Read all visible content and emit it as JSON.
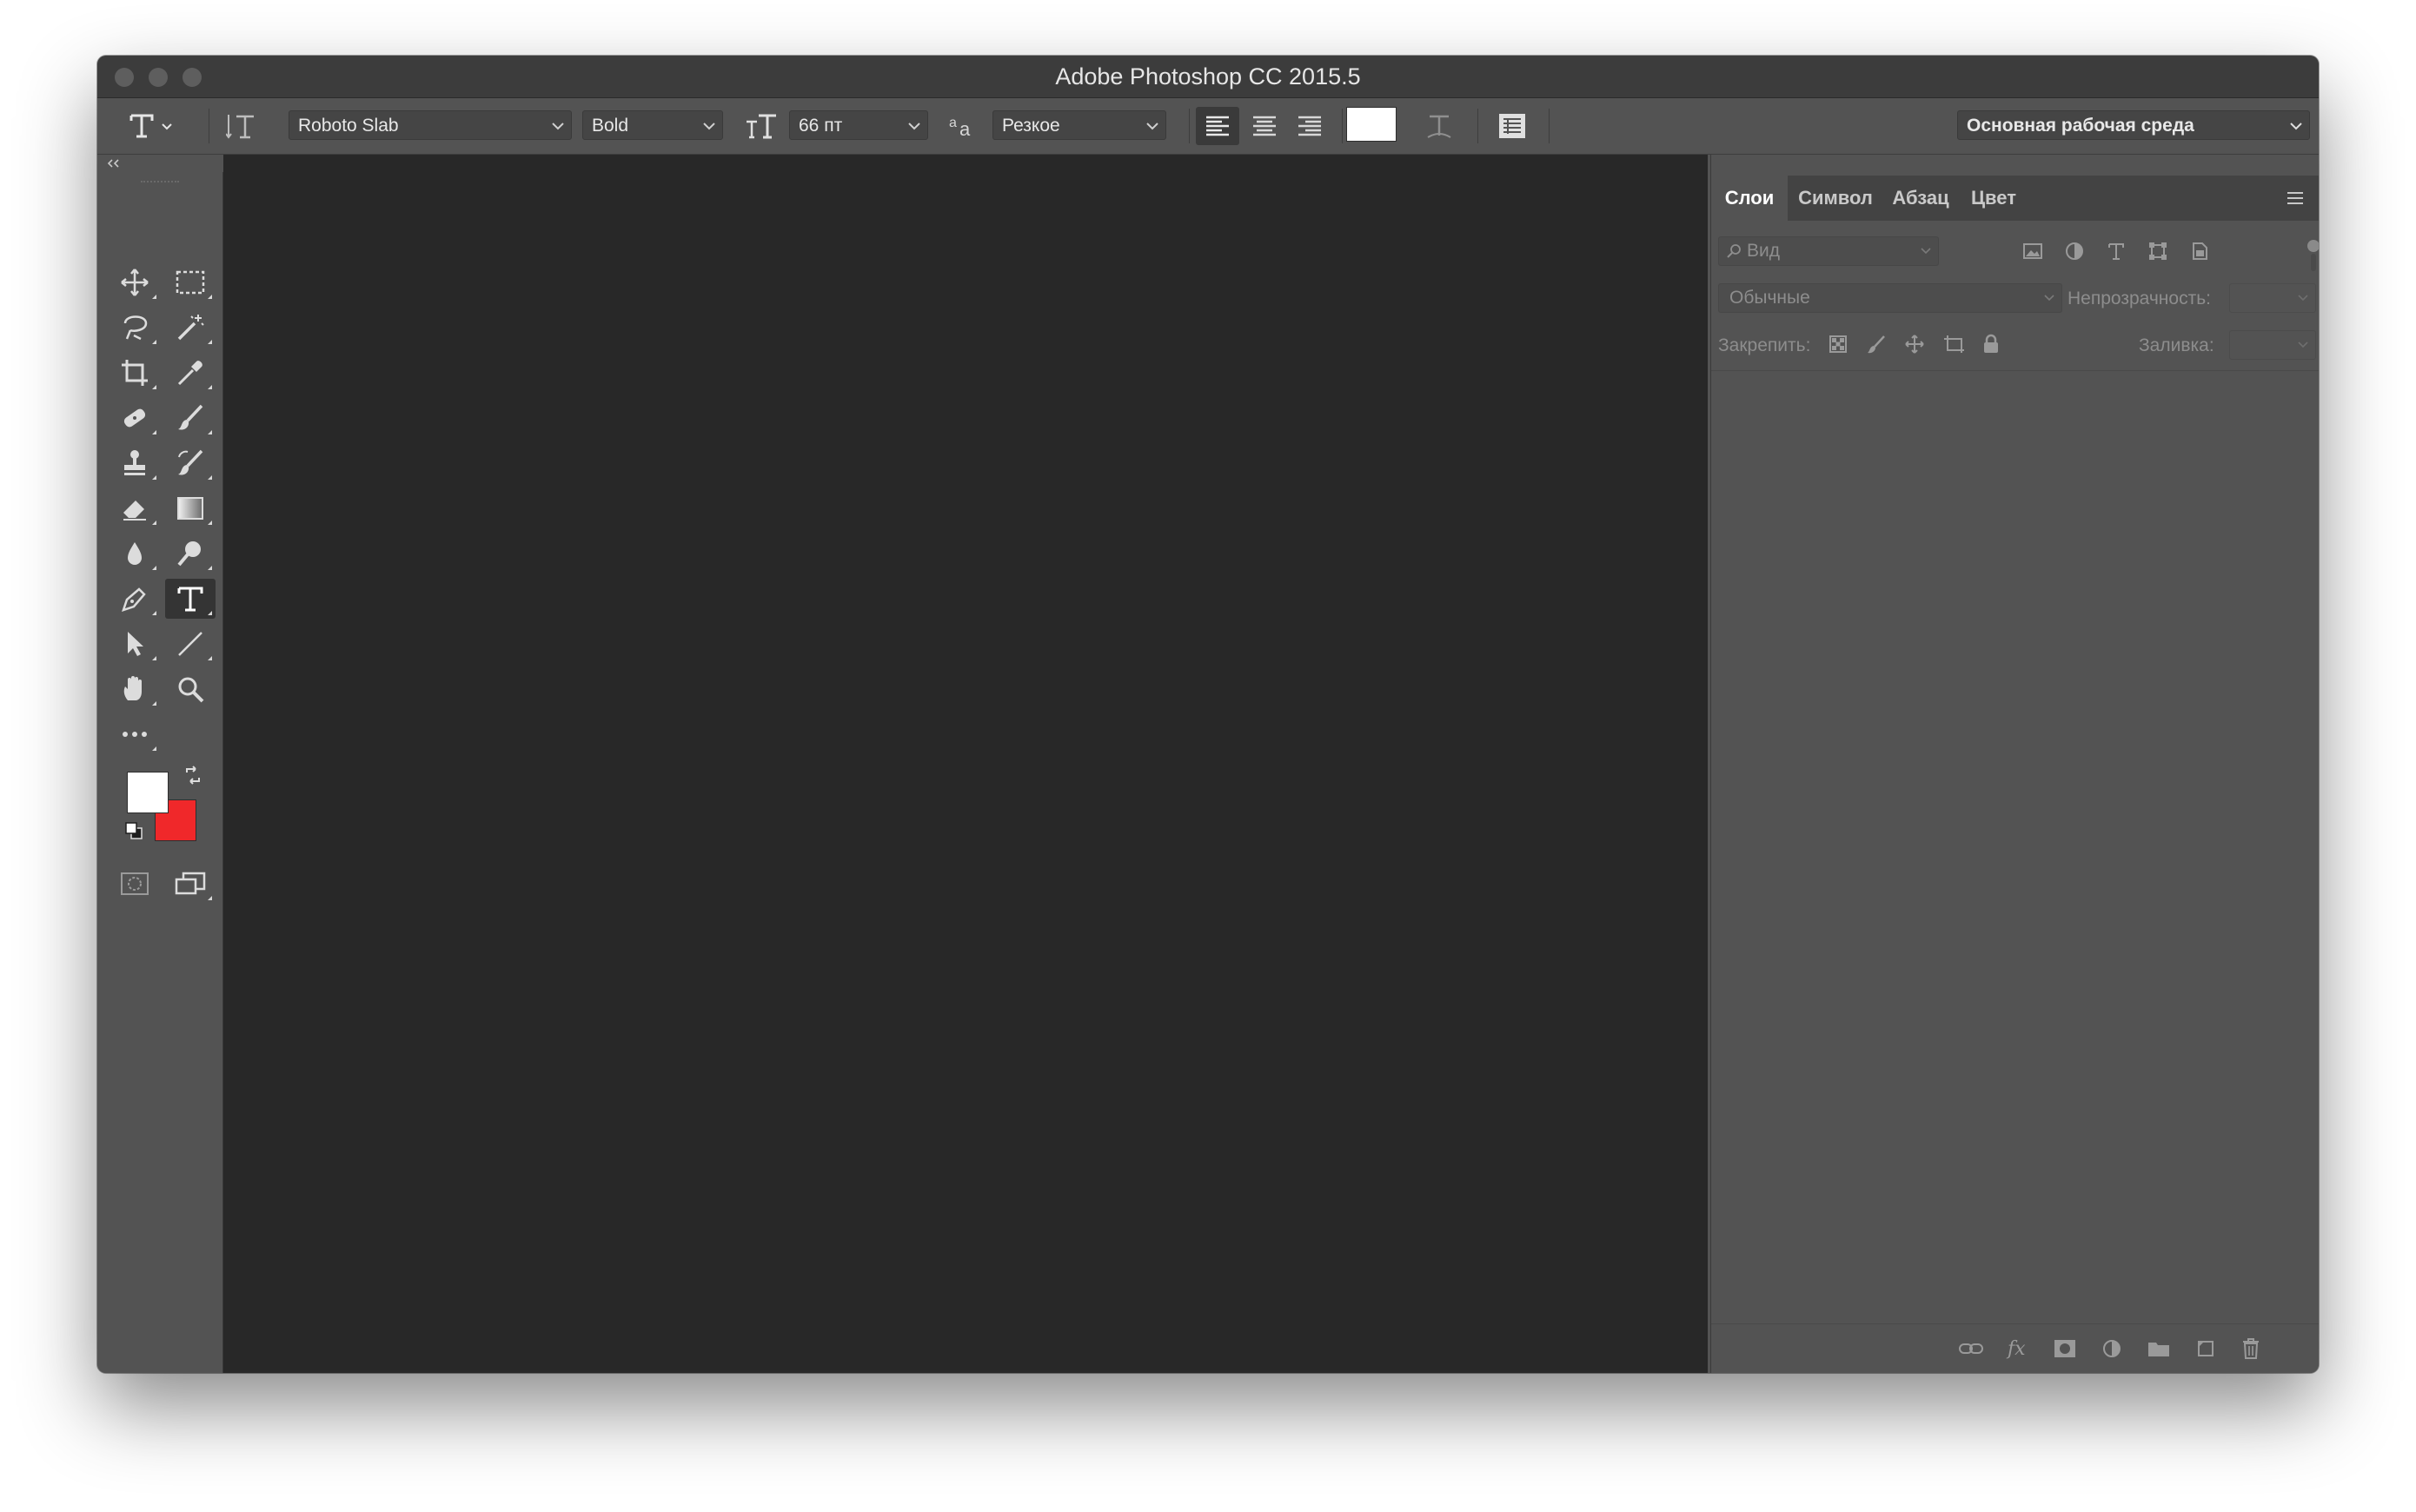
{
  "window": {
    "title": "Adobe Photoshop CC 2015.5"
  },
  "options_bar": {
    "tool_icon": "type-tool-icon",
    "font_family": "Roboto Slab",
    "font_style": "Bold",
    "font_size": "66 пт",
    "antialias": "Резкое",
    "align_left_active": true,
    "text_color": "#ffffff",
    "workspace": "Основная рабочая среда"
  },
  "tools": [
    "move-tool",
    "marquee-tool",
    "lasso-tool",
    "magic-wand-tool",
    "crop-tool",
    "eyedropper-tool",
    "healing-tool",
    "brush-tool",
    "stamp-tool",
    "history-brush-tool",
    "eraser-tool",
    "gradient-tool",
    "blur-tool",
    "dodge-tool",
    "pen-tool",
    "type-tool",
    "path-select-tool",
    "line-tool",
    "hand-tool",
    "zoom-tool",
    "more-tools"
  ],
  "active_tool": "type-tool",
  "colors": {
    "foreground": "#ffffff",
    "background": "#f0282a",
    "canvas": "#282828"
  },
  "layers_panel": {
    "tabs": [
      "Слои",
      "Символ",
      "Абзац",
      "Цвет"
    ],
    "active_tab": "Слои",
    "filter_placeholder": "Вид",
    "blend_mode": "Обычные",
    "opacity_label": "Непрозрачность:",
    "lock_label": "Закрепить:",
    "fill_label": "Заливка:"
  }
}
